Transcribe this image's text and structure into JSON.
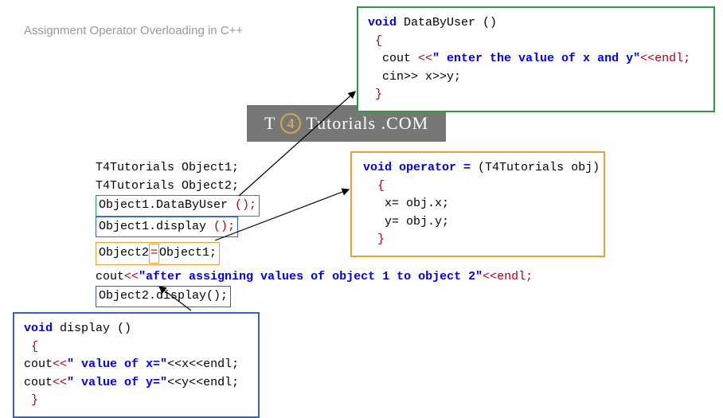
{
  "title": "Assignment Operator Overloading in C++",
  "watermark": {
    "t": "T",
    "four": "4",
    "rest": "Tutorials .COM"
  },
  "dataByUser": {
    "sig_void": "void",
    "sig_name": " DataByUser ()",
    "open": " {",
    "cout_l1_a": "  cout ",
    "cout_l1_op": "<<",
    "cout_l1_str": "\" enter the value of x and y\"",
    "cout_l1_endl": "<<endl;",
    "cin": "  cin>> x>>y;",
    "close": " }"
  },
  "operatorFn": {
    "sig_void": "void",
    "sig_op": " operator =",
    "sig_param": " (T4Tutorials obj)",
    "open": "  {",
    "l1": "   x= obj.x;",
    "l2": "   y= obj.y;",
    "close": "  }"
  },
  "displayFn": {
    "sig_void": "void",
    "sig_name": " display ()",
    "open": " {",
    "l1_a": "cout",
    "l1_op": "<<",
    "l1_str": "\" value of x=\"",
    "l1_rest": "<<x<<endl;",
    "l2_a": "cout",
    "l2_op": "<<",
    "l2_str": "\" value of y=\"",
    "l2_rest": "<<y<<endl;",
    "close": " }"
  },
  "main": {
    "l1": "T4Tutorials Object1;",
    "l2": "T4Tutorials Object2;",
    "l3_a": "Object1.DataByUser ",
    "l3_b": "();",
    "l4_a": "Object1.display ",
    "l4_b": "();",
    "l5_a": "Object2",
    "l5_eq": "=",
    "l5_b": "Object1;",
    "l6_a": "cout",
    "l6_op": "<<",
    "l6_str": "\"after assigning values of object 1 to object 2\"",
    "l6_rest": "<<endl;",
    "l7": "Object2.display();"
  }
}
